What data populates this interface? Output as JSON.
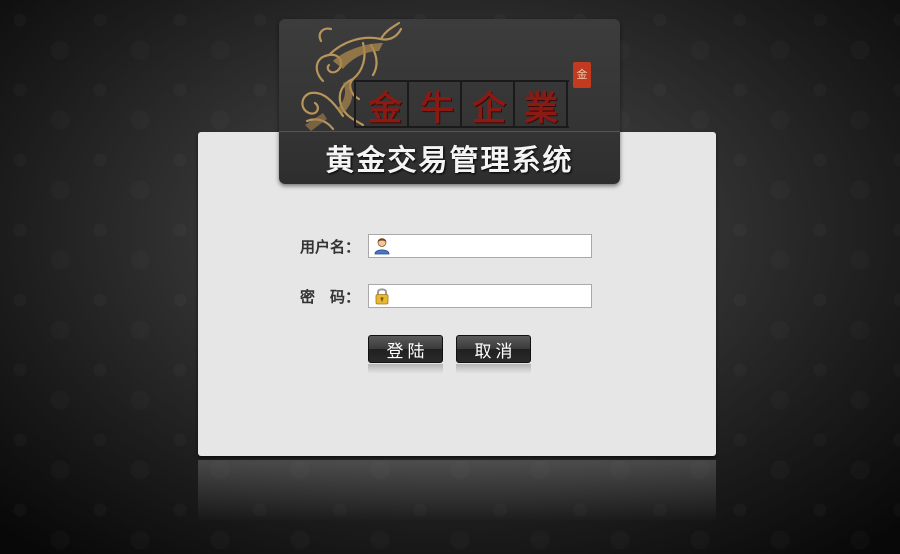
{
  "header": {
    "brand_chars": [
      "金",
      "牛",
      "企",
      "業"
    ],
    "seal_text": "金",
    "system_title": "黄金交易管理系统"
  },
  "form": {
    "username_label": "用户名：",
    "username_value": "",
    "password_label": "密　码：",
    "password_value": ""
  },
  "buttons": {
    "login_label": "登陆",
    "cancel_label": "取消"
  },
  "icons": {
    "username": "user-icon",
    "password": "lock-icon",
    "logo": "bull-logo-icon"
  },
  "colors": {
    "brand_red": "#8a1a14",
    "panel_bg": "#e6e6e6",
    "seal_red": "#c23a20",
    "logo_gold": "#b8955a"
  }
}
